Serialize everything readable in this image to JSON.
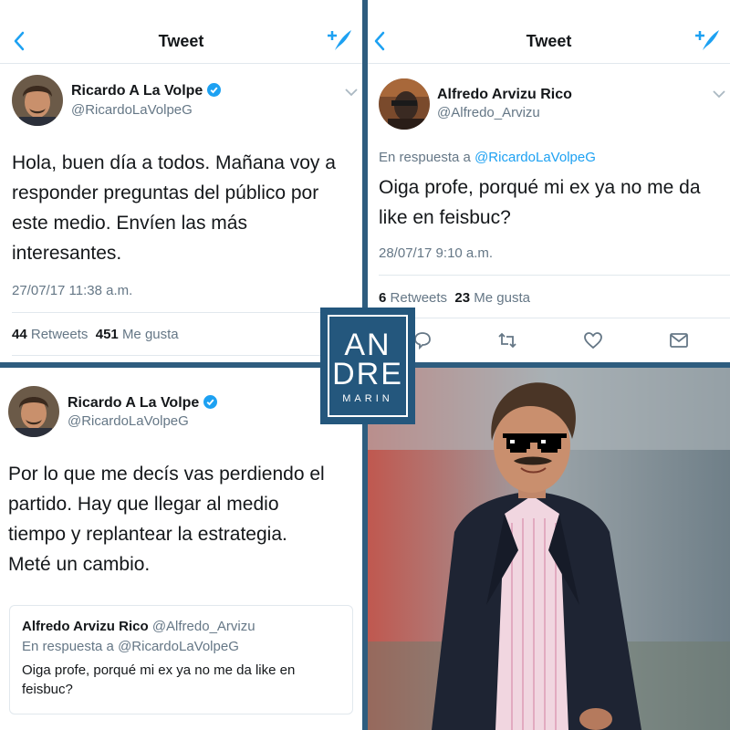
{
  "tweet1": {
    "nav_title": "Tweet",
    "author_name": "Ricardo A La Volpe",
    "author_handle": "@RicardoLaVolpeG",
    "body_lines": [
      "Hola, buen día a todos. Mañana voy a",
      "responder preguntas del público por",
      "este medio. Envíen las más",
      "interesantes."
    ],
    "timestamp": "27/07/17 11:38 a.m.",
    "retweets_count": "44",
    "retweets_label": "Retweets",
    "likes_count": "451",
    "likes_label": "Me gusta"
  },
  "tweet2": {
    "nav_title": "Tweet",
    "author_name": "Alfredo Arvizu Rico",
    "author_handle": "@Alfredo_Arvizu",
    "reply_prefix": "En respuesta a",
    "reply_mention": "@RicardoLaVolpeG",
    "body_lines": [
      "Oiga profe, porqué mi ex ya no me da",
      "like en feisbuc?"
    ],
    "timestamp": "28/07/17 9:10 a.m.",
    "retweets_count": "6",
    "retweets_label": "Retweets",
    "likes_count": "23",
    "likes_label": "Me gusta",
    "action_icons": [
      "reply-icon",
      "retweet-icon",
      "like-icon",
      "message-icon"
    ]
  },
  "tweet3": {
    "author_name": "Ricardo A La Volpe",
    "author_handle": "@RicardoLaVolpeG",
    "body_lines": [
      "Por lo que me decís vas perdiendo el",
      "partido. Hay que llegar al medio",
      "tiempo y replantear la estrategia.",
      "Meté un cambio."
    ],
    "quote": {
      "author_name": "Alfredo Arvizu Rico",
      "author_handle": "@Alfredo_Arvizu",
      "reply_line": "En respuesta a @RicardoLaVolpeG",
      "body_lines": [
        "Oiga profe, porqué mi ex ya no me da like en",
        "feisbuc?"
      ]
    }
  },
  "watermark": {
    "line1": "AN",
    "line2": "DRE",
    "line3": "MARIN"
  },
  "colors": {
    "accent": "#1da1f2",
    "muted": "#657786",
    "divider": "#e1e8ed",
    "frame": "#2e5d7f"
  }
}
